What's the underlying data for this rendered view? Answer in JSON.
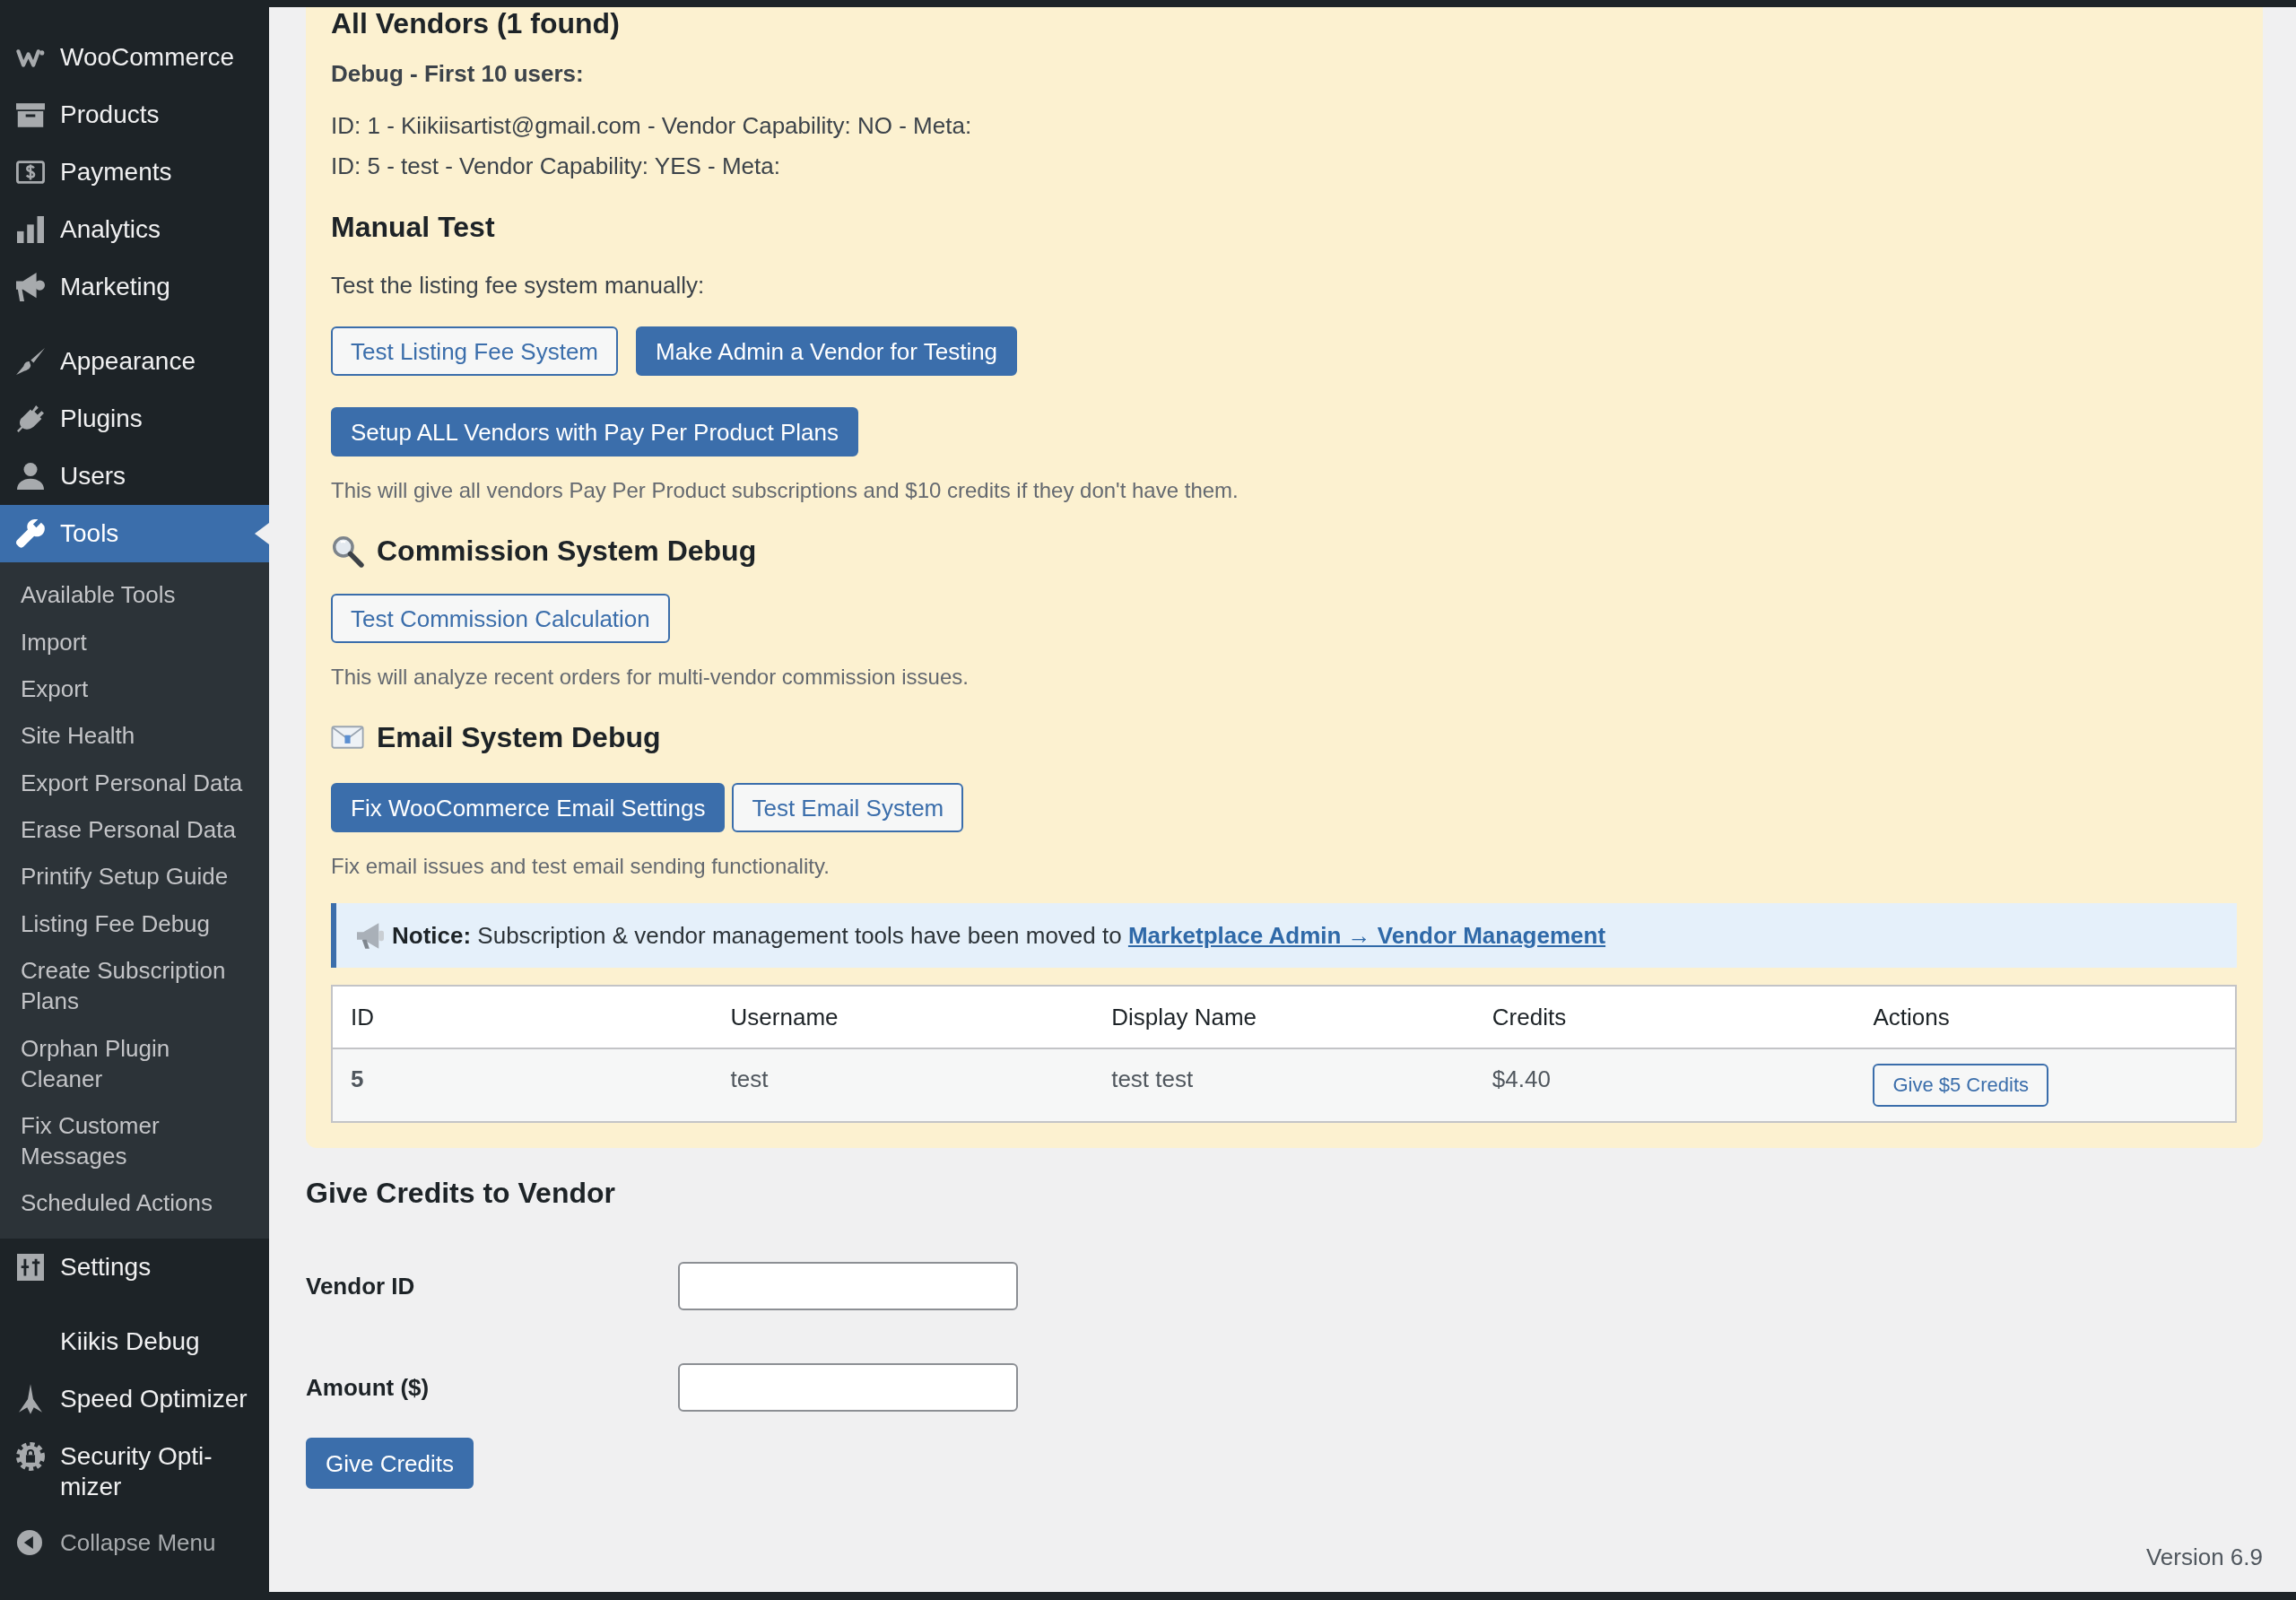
{
  "sidebar": {
    "groups": [
      {
        "items": [
          {
            "label": "WooCommerce",
            "selected": false
          },
          {
            "label": "Products",
            "selected": false
          },
          {
            "label": "Payments",
            "selected": false
          },
          {
            "label": "Analytics",
            "selected": false
          },
          {
            "label": "Marketing",
            "selected": false
          }
        ]
      },
      {
        "items": [
          {
            "label": "Appearance",
            "selected": false
          },
          {
            "label": "Plugins",
            "selected": false
          },
          {
            "label": "Users",
            "selected": false
          },
          {
            "label": "Tools",
            "selected": true,
            "children": [
              {
                "label": "Available Tools",
                "selected": false
              },
              {
                "label": "Import",
                "selected": false
              },
              {
                "label": "Export",
                "selected": false
              },
              {
                "label": "Site Health",
                "selected": false
              },
              {
                "label": "Export Personal Data",
                "selected": false
              },
              {
                "label": "Erase Personal Data",
                "selected": false
              },
              {
                "label": "Printify Setup Guide",
                "selected": false
              },
              {
                "label": "Listing Fee Debug",
                "selected": false
              },
              {
                "label": "Create Subscription Plans",
                "selected": false
              },
              {
                "label": "Orphan Plugin Cleaner",
                "selected": false
              },
              {
                "label": "Fix Customer Messages",
                "selected": false
              },
              {
                "label": "Scheduled Actions",
                "selected": false
              }
            ]
          },
          {
            "label": "Settings",
            "selected": false
          }
        ]
      },
      {
        "items": [
          {
            "label": "Kiikis Debug",
            "selected": false
          },
          {
            "label": "Speed Optimizer",
            "selected": false
          },
          {
            "label": "Security Opti-mizer",
            "selected": false
          }
        ]
      }
    ],
    "collapse_label": "Collapse Menu"
  },
  "vendors_panel": {
    "heading": "All Vendors (1 found)",
    "debug": {
      "title": "Debug - First 10 users:",
      "lines": [
        "ID: 1 - Kiikiisartist@gmail.com - Vendor Capability: NO - Meta:",
        "ID: 5 - test - Vendor Capability: YES - Meta:"
      ]
    },
    "sections": [
      {
        "heading": "Manual Test",
        "intro": "Test the listing fee system manually:",
        "button_rows": [
          [
            {
              "label": "Test Listing Fee System",
              "kind": "secondary"
            },
            {
              "label": "Make Admin a Vendor for Testing",
              "kind": "primary"
            }
          ],
          [
            {
              "label": "Setup ALL Vendors with Pay Per Product Plans",
              "kind": "primary"
            }
          ]
        ],
        "note": "This will give all vendors Pay Per Product subscriptions and $10 credits if they don't have them."
      },
      {
        "heading": "Commission System Debug",
        "button_rows": [
          [
            {
              "label": "Test Commission Calculation",
              "kind": "secondary"
            }
          ]
        ],
        "note": "This will analyze recent orders for multi-vendor commission issues."
      },
      {
        "heading": "Email System Debug",
        "button_rows": [
          [
            {
              "label": "Fix WooCommerce Email Settings",
              "kind": "primary"
            },
            {
              "label": "Test Email System",
              "kind": "secondary"
            }
          ]
        ],
        "note": "Fix email issues and test email sending functionality."
      }
    ],
    "notice": {
      "text": "**Notice:** Subscription & vendor management tools have been moved to",
      "link": "Marketplace Admin → Vendor Management"
    },
    "table": {
      "columns": [
        "ID",
        "Username",
        "Display Name",
        "Credits",
        "Actions"
      ],
      "rows": [
        {
          "cells": [
            "5",
            "test",
            "test test",
            "$4.40"
          ],
          "action": "Give $5 Credits"
        }
      ]
    }
  },
  "give_credits": {
    "heading": "Give Credits to Vendor",
    "fields": [
      {
        "label": "Vendor ID"
      },
      {
        "label": "Amount ($)"
      }
    ],
    "submit": "Give Credits"
  },
  "footer": {
    "version": "Version 6.9"
  }
}
